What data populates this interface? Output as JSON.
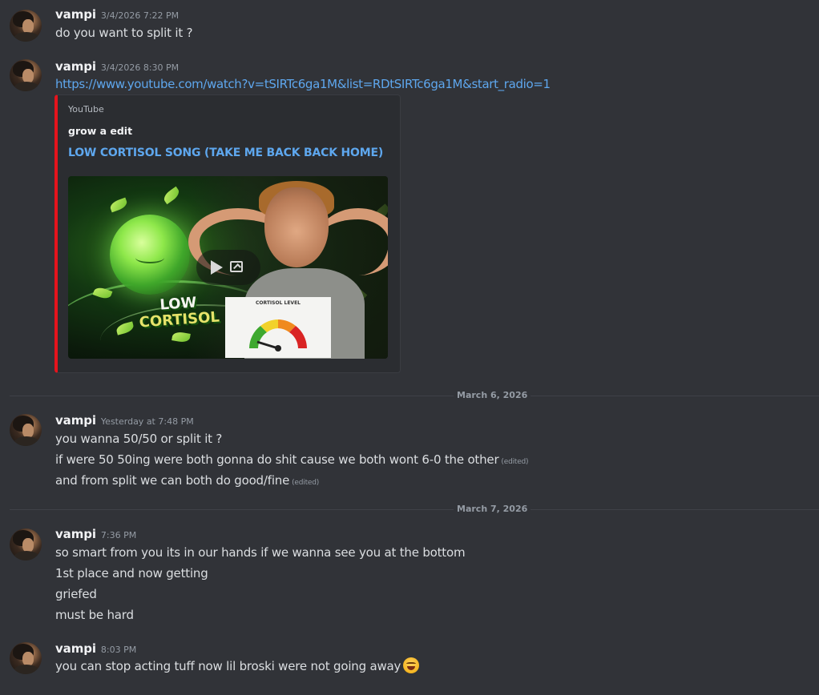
{
  "messages": [
    {
      "username": "vampi",
      "timestamp": "3/4/2026 7:22 PM",
      "lines": [
        {
          "text": "do you want to split it ?",
          "edited": ""
        }
      ]
    },
    {
      "username": "vampi",
      "timestamp": "3/4/2026 8:30 PM",
      "link": "https://www.youtube.com/watch?v=tSIRTc6ga1M&list=RDtSIRTc6ga1M&start_radio=1",
      "embed": {
        "provider": "YouTube",
        "author": "grow a edit",
        "title": "LOW CORTISOL SONG (TAKE ME BACK BACK HOME)",
        "thumbnail_text_1": "LOW",
        "thumbnail_text_2": "CORTISOL",
        "gauge_label": "CORTISOL LEVEL",
        "accent_color": "#e5141d",
        "link_color": "#5ea7ee"
      }
    },
    {
      "username": "vampi",
      "timestamp": "Yesterday at 7:48 PM",
      "lines": [
        {
          "text": "you wanna 50/50 or split it ?",
          "edited": ""
        },
        {
          "text": "if were 50 50ing were both gonna do shit cause we both wont 6-0 the other",
          "edited": "(edited)"
        },
        {
          "text": "and from split we can both do good/fine",
          "edited": "(edited)"
        }
      ]
    },
    {
      "username": "vampi",
      "timestamp": "7:36 PM",
      "lines": [
        {
          "text": "so smart from you its in our hands if we wanna see you at the bottom",
          "edited": ""
        },
        {
          "text": "1st place and now getting",
          "edited": ""
        },
        {
          "text": "griefed",
          "edited": ""
        },
        {
          "text": "must be hard",
          "edited": ""
        }
      ]
    },
    {
      "username": "vampi",
      "timestamp": "8:03 PM",
      "lines": [
        {
          "text": "you can stop acting tuff now lil broski were not going away",
          "edited": ""
        }
      ],
      "emoji": "joy-emoji"
    }
  ],
  "dividers": [
    "March 6, 2026",
    "March 7, 2026"
  ],
  "colors": {
    "background": "#313338",
    "text": "#dbdee1",
    "username": "#f2f3f5",
    "muted": "#949ba4",
    "link": "#5ea7ee",
    "embed_bar": "#e5141d"
  }
}
